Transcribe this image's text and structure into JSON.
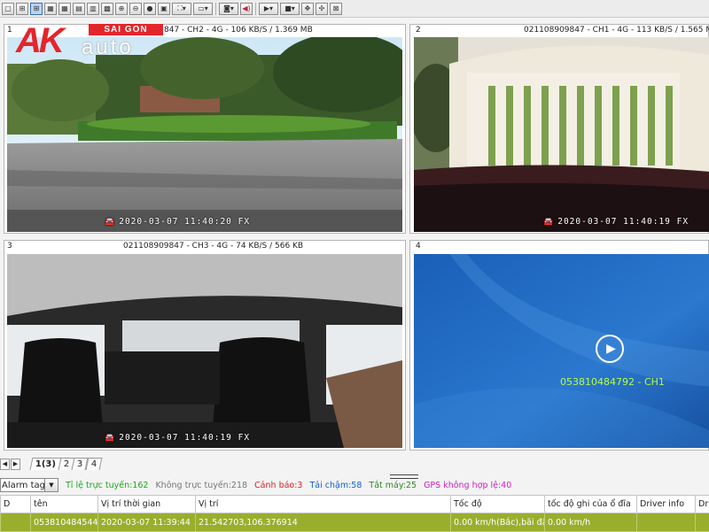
{
  "toolbar": {
    "buttons": [
      "layout-1",
      "layout-4",
      "layout-6",
      "layout-8",
      "layout-9",
      "layout-16",
      "layout-custom",
      "zoom-in",
      "zoom-out",
      "record",
      "snapshot",
      "fullscreen",
      "display-mode",
      "capture",
      "volume",
      "play",
      "stop",
      "ptz",
      "settings"
    ]
  },
  "logo": {
    "brand": "AK",
    "region": "SAI GON",
    "word": "auto"
  },
  "panes": [
    {
      "number": "1",
      "caption": "847 - CH2 - 4G - 106 KB/S / 1.369 MB",
      "timestamp": "2020-03-07 11:40:20 FX"
    },
    {
      "number": "2",
      "caption": "021108909847 - CH1 - 4G - 113 KB/S / 1.565 M",
      "timestamp": "2020-03-07 11:40:19 FX"
    },
    {
      "number": "3",
      "caption": "021108909847 - CH3 - 4G - 74 KB/S / 566 KB",
      "timestamp": "2020-03-07 11:40:19 FX"
    },
    {
      "number": "4",
      "caption": "",
      "idle_label": "053810484792 - CH1"
    }
  ],
  "tabs": {
    "items": [
      "1(3)",
      "2",
      "3",
      "4"
    ],
    "active_index": 0
  },
  "status": {
    "filter_select": "Alarm tag",
    "online_ratio": "Tỉ lệ trực tuyến:162",
    "offline": "Không trực tuyến:218",
    "warning": "Cảnh báo:3",
    "slow_upload": "Tải chậm:58",
    "engine_off": "Tắt máy:25",
    "gps_invalid": "GPS không hợp lệ:40",
    "colors": {
      "online": "#1ca81c",
      "offline": "#777777",
      "warning": "#e01e1e",
      "slow": "#1060d0",
      "engine": "#2f8a20",
      "gps": "#d020c0"
    }
  },
  "table": {
    "columns": [
      "D",
      "tên",
      "Vị trí thời gian",
      "Vị trí",
      "Tốc độ",
      "tốc độ ghi của ổ đĩa",
      "Driver info",
      "Dr"
    ],
    "rows": [
      [
        "",
        "053810484544",
        "2020-03-07 11:39:44",
        "21.542703,106.376914",
        "0.00 km/h(Bắc),bãi đậu",
        "0.00 km/h",
        "",
        ""
      ]
    ],
    "row_color": "#9aae2e"
  }
}
